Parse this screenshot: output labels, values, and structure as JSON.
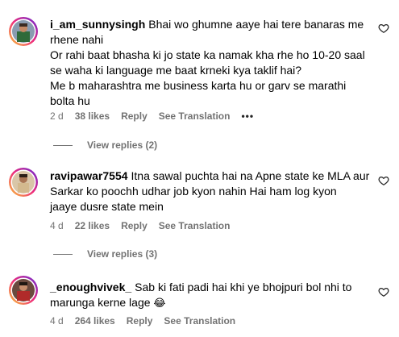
{
  "comments": [
    {
      "username": "i_am_sunnysingh",
      "lines": [
        "Bhai wo ghumne aaye hai tere banaras me",
        "rhene nahi",
        "Or rahi baat bhasha ki jo state ka namak kha rhe ho 10-20 saal",
        "se waha ki language me baat krneki kya taklif hai?",
        "Me b maharashtra me business karta hu or garv se marathi",
        "bolta hu"
      ],
      "age": "2 d",
      "likes": "38 likes",
      "reply": "Reply",
      "translate": "See Translation",
      "more": "•••",
      "view_replies": "View replies (2)"
    },
    {
      "username": "ravipawar7554",
      "lines": [
        "Itna sawal puchta hai na Apne state ke MLA aur",
        "Sarkar ko poochh udhar job kyon nahin Hai ham log kyon",
        "jaaye dusre state mein"
      ],
      "age": "4 d",
      "likes": "22 likes",
      "reply": "Reply",
      "translate": "See Translation",
      "view_replies": "View replies (3)"
    },
    {
      "username": "_enoughvivek_",
      "lines": [
        "Sab ki fati padi hai khi ye bhojpuri bol nhi to",
        "marunga kerne lage"
      ],
      "emoji": "😂",
      "age": "4 d",
      "likes": "264 likes",
      "reply": "Reply",
      "translate": "See Translation"
    }
  ],
  "colors": {
    "meta": "#737373",
    "text": "#000000",
    "background": "#ffffff"
  },
  "icons": {
    "like": "heart-outline-icon",
    "more": "more-horizontal-icon"
  }
}
